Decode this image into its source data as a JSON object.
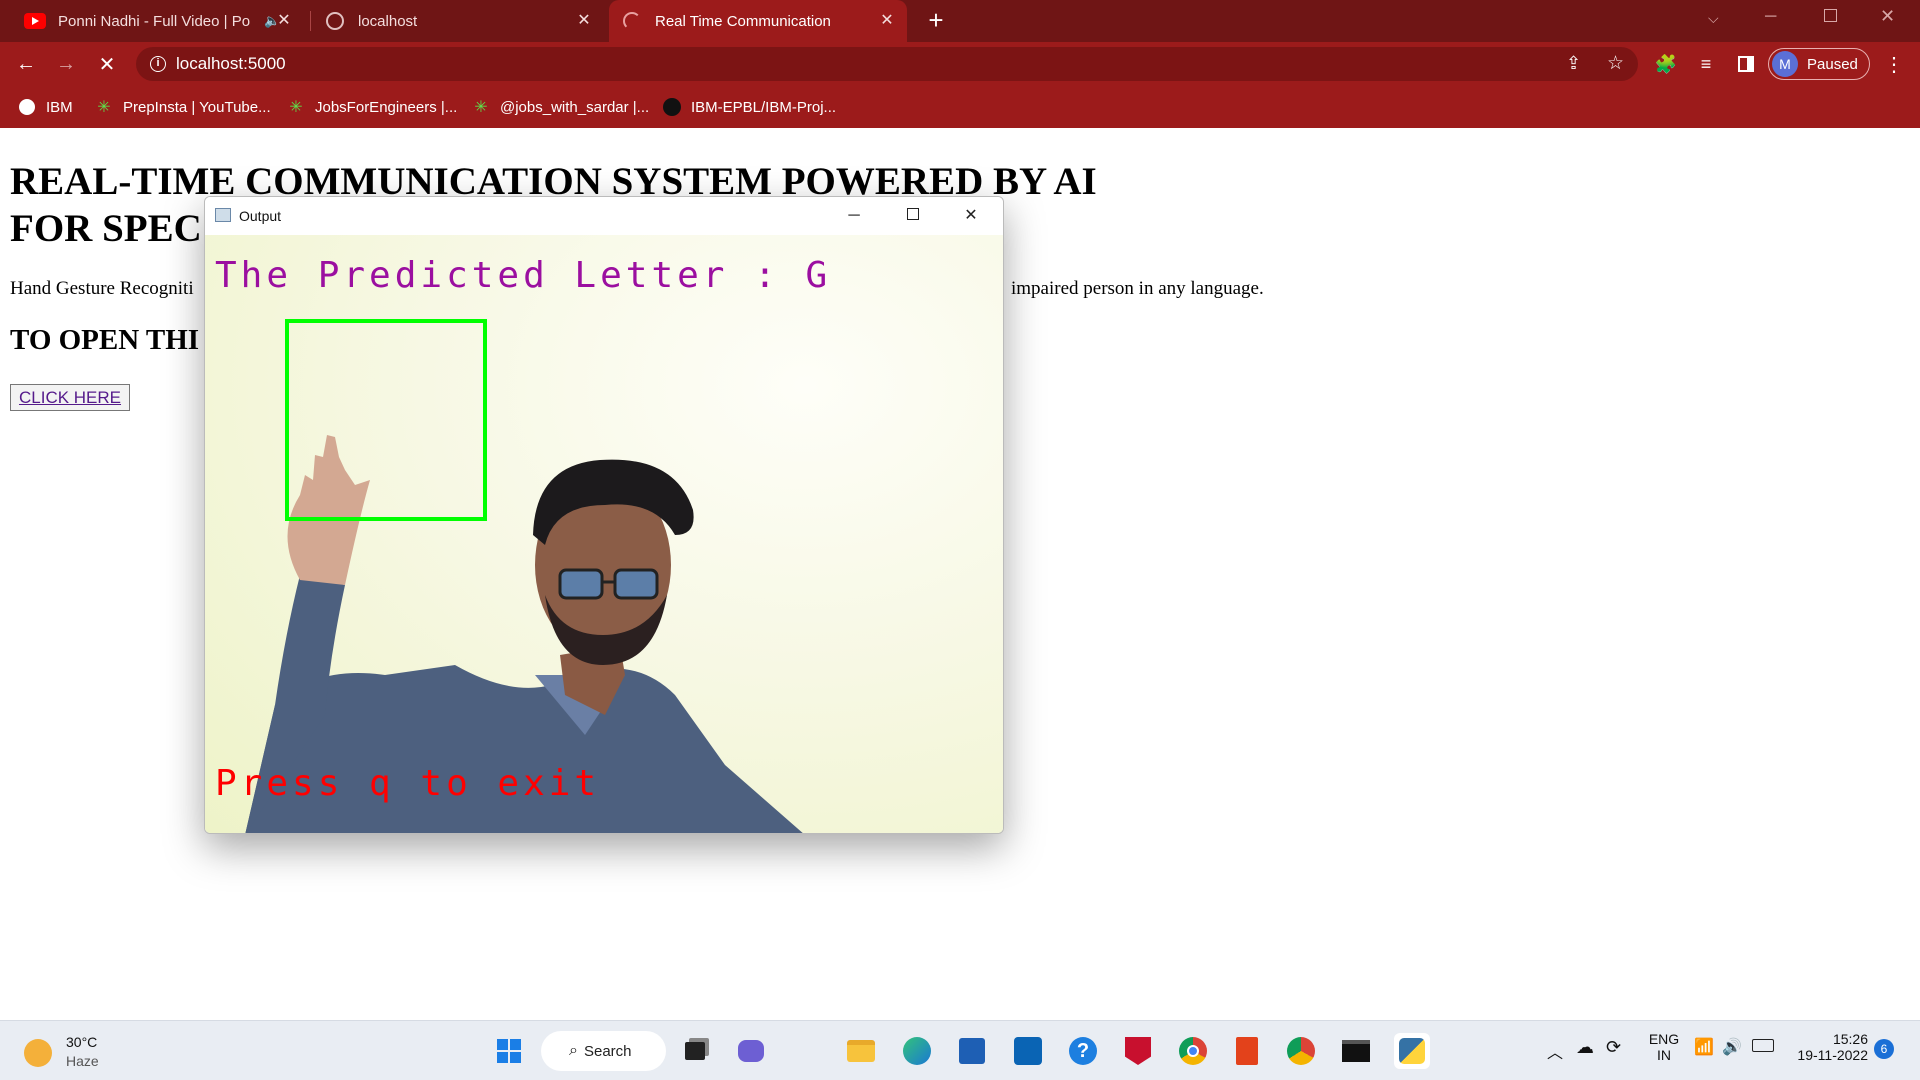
{
  "browser": {
    "tabs": [
      {
        "title": "Ponni Nadhi - Full Video | Po",
        "favicon": "youtube-icon",
        "audio": true
      },
      {
        "title": "localhost",
        "favicon": "globe-icon"
      },
      {
        "title": "Real Time Communication",
        "favicon": "loading-spinner-icon",
        "active": true
      }
    ],
    "new_tab_label": "+",
    "address": "localhost:5000",
    "profile_initial": "M",
    "profile_status": "Paused",
    "bookmarks": [
      {
        "label": "IBM",
        "icon": "globe-icon"
      },
      {
        "label": "PrepInsta | YouTube...",
        "icon": "asterisk-icon"
      },
      {
        "label": "JobsForEngineers |...",
        "icon": "asterisk-icon"
      },
      {
        "label": "@jobs_with_sardar |...",
        "icon": "asterisk-icon"
      },
      {
        "label": "IBM-EPBL/IBM-Proj...",
        "icon": "github-icon"
      }
    ],
    "colors": {
      "tabstrip": "#6f1515",
      "toolbar": "#9c1b1b"
    }
  },
  "page": {
    "heading_line1": "REAL-TIME COMMUNICATION SYSTEM POWERED BY AI",
    "heading_line2": "FOR SPEC",
    "description_left": "Hand Gesture Recogniti",
    "description_right": "impaired person in any language.",
    "subheading": "TO OPEN THI",
    "button_label": "CLICK HERE"
  },
  "output_window": {
    "title": "Output",
    "predicted_text": "The Predicted Letter : G",
    "exit_text": "Press q to exit",
    "colors": {
      "predicted": "#9b0fa0",
      "exit": "#ff0000",
      "roi_box": "#00ff00"
    }
  },
  "taskbar": {
    "weather_temp": "30°C",
    "weather_desc": "Haze",
    "search_label": "Search",
    "lang_line1": "ENG",
    "lang_line2": "IN",
    "time": "15:26",
    "date": "19-11-2022",
    "notifications": "6",
    "pinned_apps": [
      "windows-start-icon",
      "task-view-icon",
      "teams-chat-icon",
      "file-explorer-icon",
      "edge-icon",
      "microsoft-store-icon",
      "app-icon",
      "help-icon",
      "mcafee-icon",
      "chrome-icon",
      "office-icon",
      "chrome-profile-icon",
      "terminal-icon",
      "python-icon"
    ]
  }
}
